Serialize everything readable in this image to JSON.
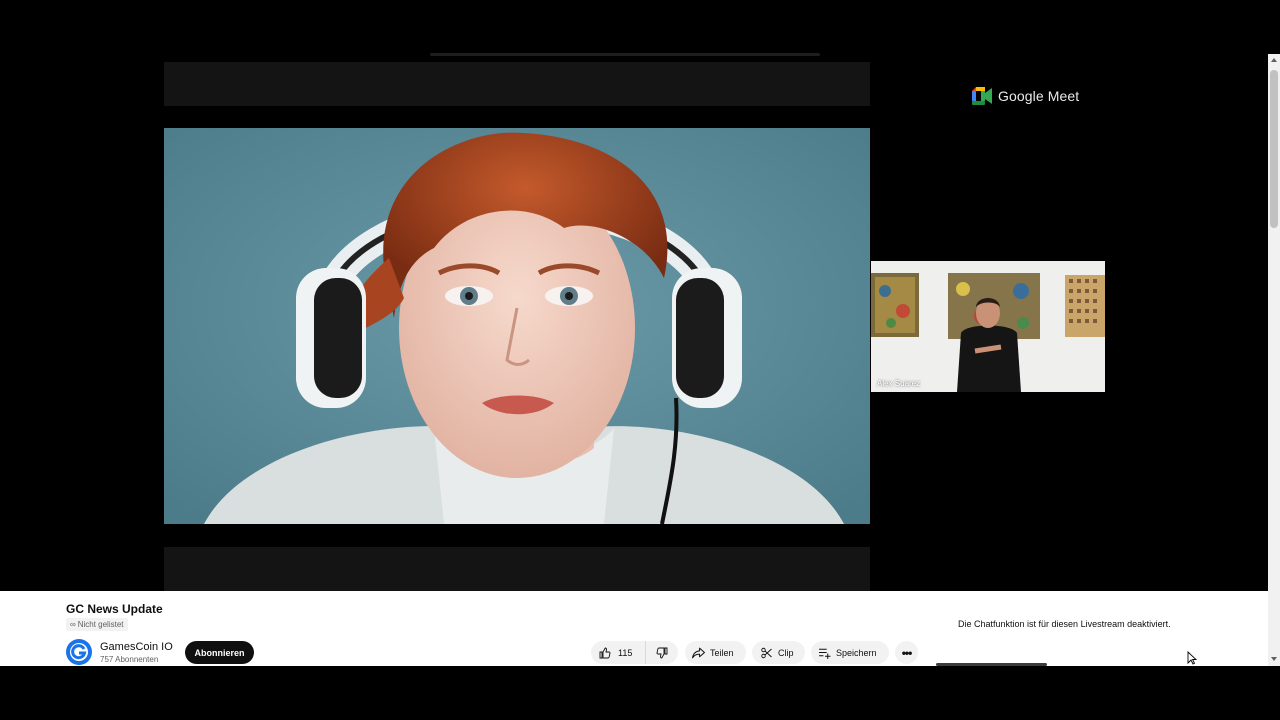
{
  "meet": {
    "brand": "Google Meet"
  },
  "participant": {
    "name": "Alex Suarez"
  },
  "video": {
    "title": "GC News Update",
    "visibility": "Nicht gelistet"
  },
  "channel": {
    "name": "GamesCoin IO",
    "subscribers": "757 Abonnenten",
    "subscribe_label": "Abonnieren"
  },
  "actions": {
    "like_count": "115",
    "share_label": "Teilen",
    "clip_label": "Clip",
    "save_label": "Speichern",
    "more_label": "•••"
  },
  "chat": {
    "disabled_message": "Die Chatfunktion ist für diesen Livestream deaktiviert."
  },
  "icons": {
    "like": "thumb-up-icon",
    "dislike": "thumb-down-icon",
    "share": "share-arrow-icon",
    "clip": "scissors-icon",
    "save": "playlist-add-icon",
    "unlisted": "link-icon",
    "meet": "meet-camera-icon",
    "cursor": "mouse-pointer-icon"
  },
  "colors": {
    "youtube_text": "#0f0f0f",
    "secondary_text": "#606060",
    "pill_bg": "#f2f2f2",
    "subscribe_bg": "#0f0f0f",
    "meet_blue": "#4285f4",
    "meet_green": "#34a853",
    "meet_yellow": "#fbbc04",
    "meet_red": "#ea4335"
  }
}
